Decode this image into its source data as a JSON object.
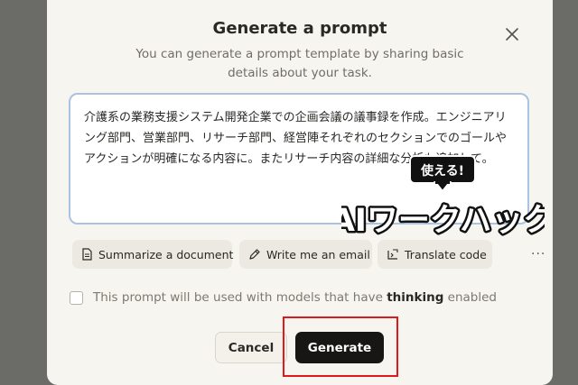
{
  "dialog": {
    "title": "Generate a prompt",
    "subtitle": "You can generate a prompt template by sharing basic details about your task.",
    "close_icon": "close-icon"
  },
  "task_input": {
    "value": "介護系の業務支援システム開発企業での企画会議の議事録を作成。エンジニアリング部門、営業部門、リサーチ部門、経営陣それぞれのセクションでのゴールやアクションが明確になる内容に。またリサーチ内容の詳細な分析も追加して。"
  },
  "templates": [
    {
      "icon": "document-icon",
      "label": "Summarize a document"
    },
    {
      "icon": "pen-icon",
      "label": "Write me an email"
    },
    {
      "icon": "translate-icon",
      "label": "Translate code"
    }
  ],
  "more_label": "···",
  "thinking_option": {
    "checked": false,
    "label_before": "This prompt will be used with models that have ",
    "label_bold": "thinking",
    "label_after": " enabled"
  },
  "buttons": {
    "cancel": "Cancel",
    "generate": "Generate"
  },
  "watermark": {
    "bubble_text": "使える!",
    "logo_text": "AIワークハック"
  },
  "colors": {
    "highlight": "#e01a1a",
    "generate_bg": "#171614",
    "input_border": "#a9c3e0"
  }
}
